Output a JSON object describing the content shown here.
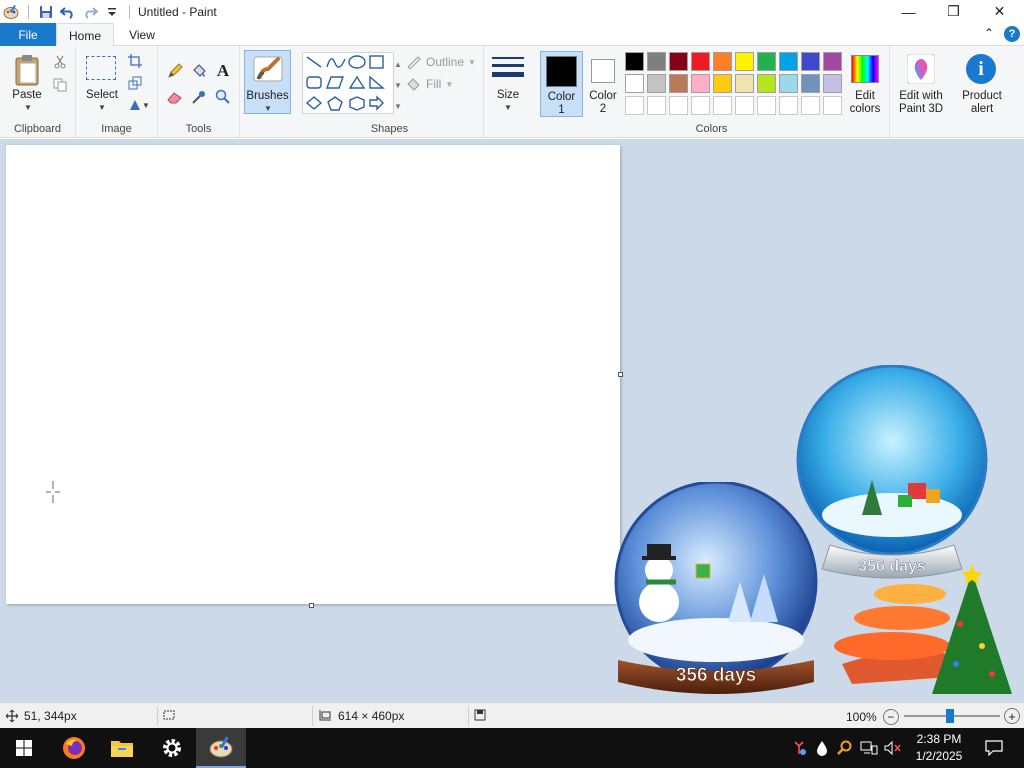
{
  "window": {
    "title": "Untitled - Paint",
    "minimize_glyph": "—",
    "maximize_glyph": "❐",
    "close_glyph": "✕"
  },
  "tabs": {
    "file": "File",
    "home": "Home",
    "view": "View",
    "collapse_glyph": "⌃",
    "help_glyph": "?"
  },
  "ribbon": {
    "clipboard": {
      "label": "Clipboard",
      "paste": "Paste"
    },
    "image": {
      "label": "Image",
      "select": "Select"
    },
    "tools": {
      "label": "Tools",
      "text_glyph": "A"
    },
    "brushes": {
      "label": "Brushes"
    },
    "shapes": {
      "label": "Shapes",
      "outline": "Outline",
      "fill": "Fill"
    },
    "size": {
      "label": "Size"
    },
    "colors": {
      "label": "Colors",
      "color1_line1": "Color",
      "color1_line2": "1",
      "color2_line1": "Color",
      "color2_line2": "2",
      "color1_value": "#000000",
      "color2_value": "#ffffff",
      "palette_row1": [
        "#000000",
        "#7f7f7f",
        "#880015",
        "#ed1c24",
        "#ff7f27",
        "#fff200",
        "#22b14c",
        "#00a2e8",
        "#3f48cc",
        "#a349a4"
      ],
      "palette_row2": [
        "#ffffff",
        "#c3c3c3",
        "#b97a57",
        "#ffaec9",
        "#ffc90e",
        "#efe4b0",
        "#b5e61d",
        "#99d9ea",
        "#7092be",
        "#c8bfe7"
      ],
      "edit_line1": "Edit",
      "edit_line2": "colors"
    },
    "paint3d": {
      "line1": "Edit with",
      "line2": "Paint 3D"
    },
    "product_alert": {
      "line1": "Product",
      "line2": "alert",
      "glyph": "i"
    }
  },
  "status": {
    "cursor_position": "51, 344px",
    "canvas_size": "614 × 460px",
    "zoom": "100%",
    "zoom_out_glyph": "−",
    "zoom_in_glyph": "+"
  },
  "desktop": {
    "globe_caption": "356 days",
    "globe2_caption": "356 days"
  },
  "taskbar": {
    "time": "2:38 PM",
    "date": "1/2/2025"
  }
}
